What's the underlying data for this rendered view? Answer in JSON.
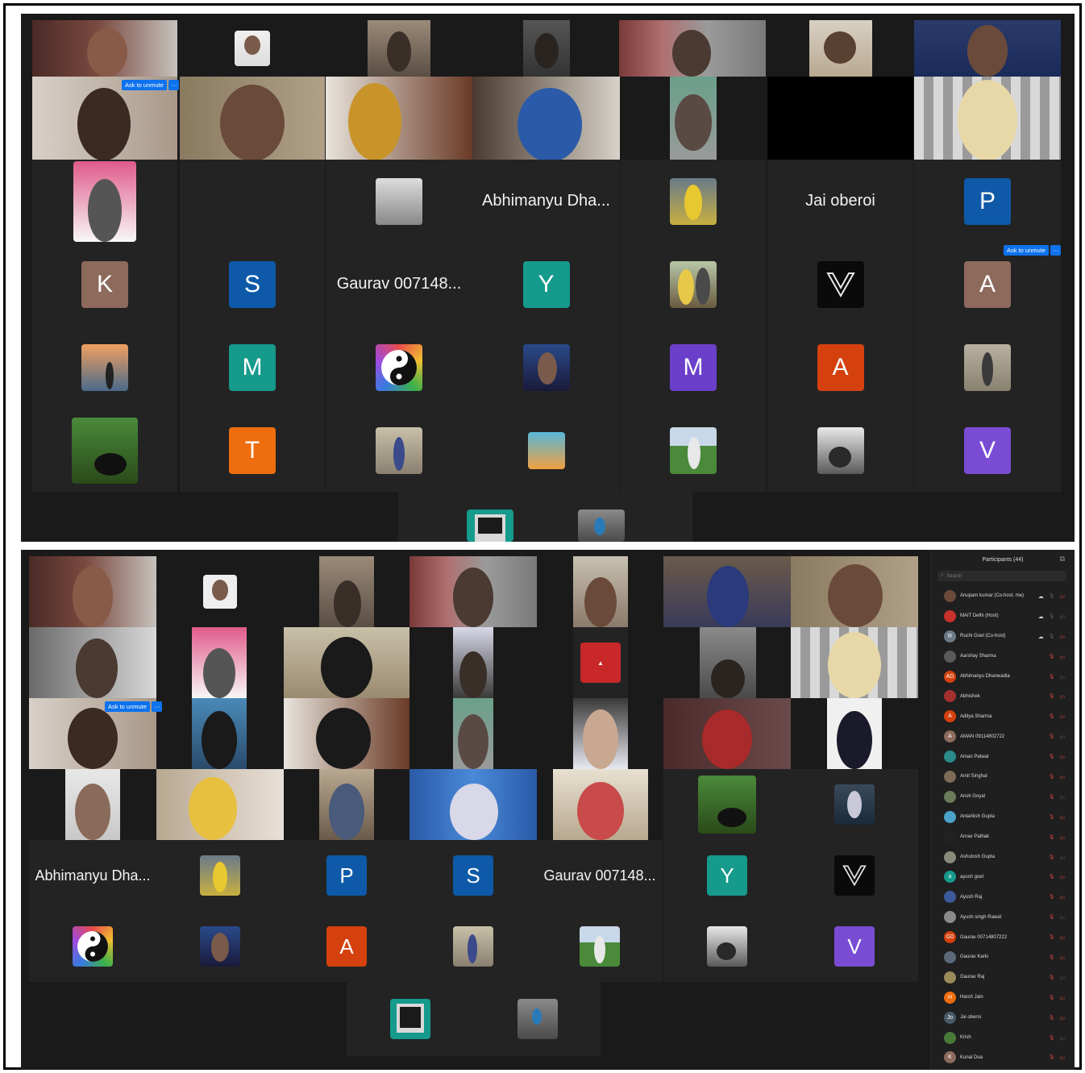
{
  "screens": {
    "top": {
      "names": [
        "Abhimanyu Dha...",
        "Jai oberoi",
        "Gaurav 007148..."
      ],
      "avatars": [
        {
          "letter": "P",
          "color": "#0e5aa8"
        },
        {
          "letter": "K",
          "color": "#8d6a5c"
        },
        {
          "letter": "S",
          "color": "#0e5aa8"
        },
        {
          "letter": "Y",
          "color": "#159a8c"
        },
        {
          "letter": "A",
          "color": "#8d6a5c"
        },
        {
          "letter": "M",
          "color": "#159a8c"
        },
        {
          "letter": "M",
          "color": "#6b3fc9"
        },
        {
          "letter": "A",
          "color": "#d4410e"
        },
        {
          "letter": "T",
          "color": "#ee6d0e"
        },
        {
          "letter": "V",
          "color": "#7a4cd4"
        }
      ],
      "ask_to_unmute": "Ask to unmute",
      "more": "···"
    },
    "bottom": {
      "names": [
        "Abhimanyu Dha...",
        "Gaurav 007148..."
      ],
      "avatars": [
        {
          "letter": "P",
          "color": "#0e5aa8"
        },
        {
          "letter": "S",
          "color": "#0e5aa8"
        },
        {
          "letter": "Y",
          "color": "#159a8c"
        },
        {
          "letter": "A",
          "color": "#d4410e"
        },
        {
          "letter": "V",
          "color": "#7a4cd4"
        }
      ],
      "ask_to_unmute": "Ask to unmute",
      "more": "···"
    }
  },
  "participants": {
    "title": "Participants (44)",
    "search_placeholder": "Search",
    "list": [
      {
        "name": "Anupam kumar (Co-host, me)",
        "initials": "",
        "color": "#6b4a3a",
        "cloud": true
      },
      {
        "name": "MAIT Delhi (Host)",
        "initials": "",
        "color": "#c9312d",
        "cloud": true
      },
      {
        "name": "Ruchi Goel (Co-host)",
        "initials": "R",
        "color": "#6b7a86",
        "cloud": true
      },
      {
        "name": "Aarshay Sharma",
        "initials": "",
        "color": "#5a5a5a"
      },
      {
        "name": "Abhimanyu Dhanwadia",
        "initials": "AD",
        "color": "#d4410e"
      },
      {
        "name": "Abhishek",
        "initials": "",
        "color": "#a33030"
      },
      {
        "name": "Aditya Sharma",
        "initials": "A",
        "color": "#d4410e"
      },
      {
        "name": "AMAN 09114802722",
        "initials": "A",
        "color": "#8d6a5c"
      },
      {
        "name": "Aman Patwal",
        "initials": "",
        "color": "#2b8a8a"
      },
      {
        "name": "Amit Singhal",
        "initials": "",
        "color": "#7b6b55"
      },
      {
        "name": "Ansh Goyal",
        "initials": "",
        "color": "#6a7a5a"
      },
      {
        "name": "Antariksh Gupta",
        "initials": "",
        "color": "#4aa3c9"
      },
      {
        "name": "Arnav Pathak",
        "initials": "",
        "color": "#222222"
      },
      {
        "name": "Ashutosh Gupta",
        "initials": "",
        "color": "#8a8a7a"
      },
      {
        "name": "ayush goel",
        "initials": "a",
        "color": "#159a8c"
      },
      {
        "name": "Ayush Raj",
        "initials": "",
        "color": "#3a5a9a"
      },
      {
        "name": "Ayush singh Rawat",
        "initials": "",
        "color": "#8a8a8a"
      },
      {
        "name": "Gaurav 00714807222",
        "initials": "G0",
        "color": "#d4410e"
      },
      {
        "name": "Gaurav Karki",
        "initials": "",
        "color": "#5a6a7a"
      },
      {
        "name": "Gaurav Raj",
        "initials": "",
        "color": "#9a8a5a"
      },
      {
        "name": "Harsh Jain",
        "initials": "H",
        "color": "#ee6d0e"
      },
      {
        "name": "Jai oberoi",
        "initials": "Jo",
        "color": "#4a5a6a"
      },
      {
        "name": "Krish",
        "initials": "",
        "color": "#4a7a3a"
      },
      {
        "name": "Kunal Dua",
        "initials": "K",
        "color": "#8d6a5c"
      }
    ]
  },
  "colors": {
    "background": "#1a1a1a",
    "tile": "#232323",
    "accent_blue": "#0e72ed",
    "active_speaker": "#2fa84a",
    "muted_red": "#e04646"
  }
}
